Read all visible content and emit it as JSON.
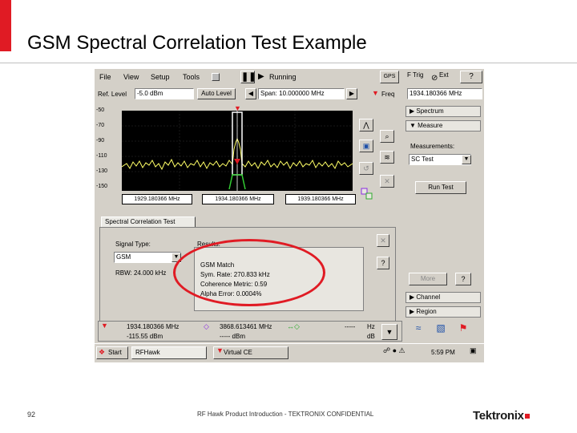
{
  "slide": {
    "title": "GSM Spectral Correlation Test Example",
    "page_number": "92",
    "footer": "RF Hawk Product Introduction - TEKTRONIX CONFIDENTIAL",
    "logo": "Tektronix",
    "brand_red": "#e01b24"
  },
  "app": {
    "menu": [
      "File",
      "View",
      "Setup",
      "Tools"
    ],
    "status": "Running",
    "gps_label": "GPS",
    "trig_label": "F Trig",
    "ext_label": "Ext",
    "help_label": "?",
    "ref_level_label": "Ref. Level",
    "ref_level_value": "-5.0 dBm",
    "auto_level_label": "Auto Level",
    "span_value": "Span: 10.000000 MHz",
    "freq_label": "Freq",
    "freq_value": "1934.180366 MHz",
    "y_ticks": [
      "-50",
      "-70",
      "-90",
      "-110",
      "-130",
      "-150"
    ],
    "freq_markers": [
      "1929.180366 MHz",
      "1934.180366 MHz",
      "1939.180366 MHz"
    ],
    "tab_label": "Spectral Correlation Test",
    "signal_type_label": "Signal Type:",
    "signal_type_value": "GSM",
    "rbw_label": "RBW: 24.000 kHz",
    "results_label": "Results:",
    "results": [
      "GSM Match",
      "Sym. Rate: 270.833 kHz",
      "Coherence Metric: 0.59",
      "Alpha Error: 0.0004%"
    ],
    "right_panel": {
      "spectrum": "Spectrum",
      "measure": "Measure",
      "measurements_label": "Measurements:",
      "measurement_value": "SC Test",
      "run_test": "Run Test",
      "more": "More",
      "channel": "Channel",
      "region": "Region"
    },
    "bottom_markers": {
      "m1_freq": "1934.180366 MHz",
      "m1_level": "-115.55 dBm",
      "m2_freq": "3868.613461 MHz",
      "m2_level": "-----   dBm",
      "delta_val": "-----",
      "delta_unit_freq": "Hz",
      "delta_unit_db": "dB"
    },
    "taskbar": {
      "start": "Start",
      "task1": "RFHawk",
      "task2": "Virtual CE",
      "time": "5:59 PM"
    }
  }
}
